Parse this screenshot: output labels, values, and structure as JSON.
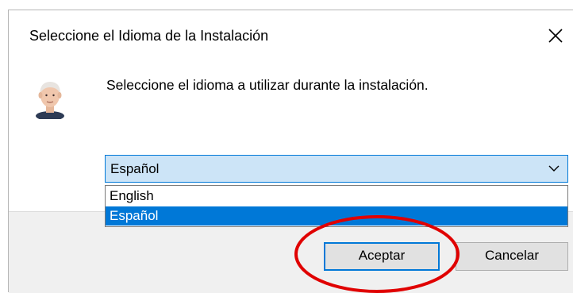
{
  "dialog": {
    "title": "Seleccione el Idioma de la Instalación",
    "prompt": "Seleccione el idioma a utilizar durante la instalación."
  },
  "language_select": {
    "selected": "Español",
    "options": [
      "English",
      "Español"
    ],
    "highlighted_index": 1
  },
  "buttons": {
    "accept_label": "Aceptar",
    "cancel_label": "Cancelar"
  },
  "icons": {
    "close": "close-icon",
    "avatar": "setup-avatar-icon",
    "chevron": "chevron-down-icon"
  },
  "colors": {
    "accent": "#0078d7",
    "combo_bg": "#cce4f7",
    "annotation": "#e00000"
  }
}
